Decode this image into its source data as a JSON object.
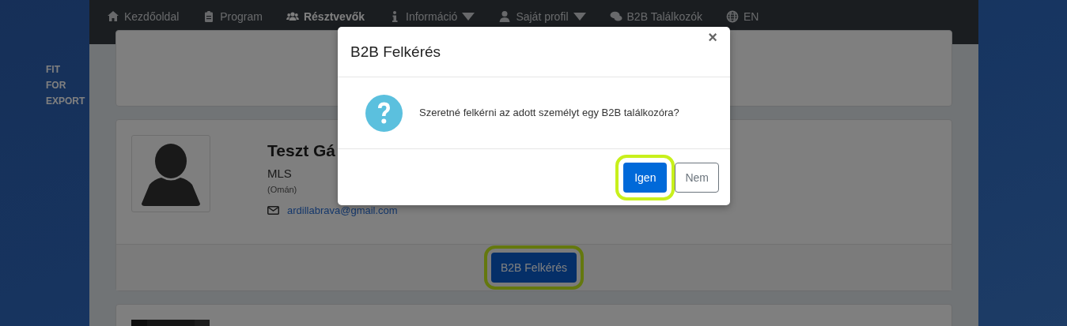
{
  "logo": [
    "FIT",
    "FOR",
    "EXPORT"
  ],
  "nav": [
    {
      "label": "Kezdőoldal",
      "dropdown": false,
      "selected": false
    },
    {
      "label": "Program",
      "dropdown": false,
      "selected": false
    },
    {
      "label": "Résztvevők",
      "dropdown": false,
      "selected": true
    },
    {
      "label": "Információ",
      "dropdown": true,
      "selected": false
    },
    {
      "label": "Saját profil",
      "dropdown": true,
      "selected": false
    },
    {
      "label": "B2B Találkozók",
      "dropdown": false,
      "selected": false
    },
    {
      "label": "EN",
      "dropdown": false,
      "selected": false
    }
  ],
  "participant": {
    "name": "Teszt Gá",
    "company": "MLS",
    "country": "(Omán)",
    "email": "ardillabrava@gmail.com",
    "button": {
      "label": "B2B Felkérés",
      "highlighted": true
    }
  },
  "modal": {
    "title": "B2B Felkérés",
    "close": "×",
    "message": "Szeretné felkérni az adott személyt egy B2B találkozóra?",
    "buttons": [
      {
        "label": "Igen",
        "kind": "primary",
        "highlighted": true
      },
      {
        "label": "Nem",
        "kind": "secondary",
        "highlighted": false
      }
    ]
  }
}
